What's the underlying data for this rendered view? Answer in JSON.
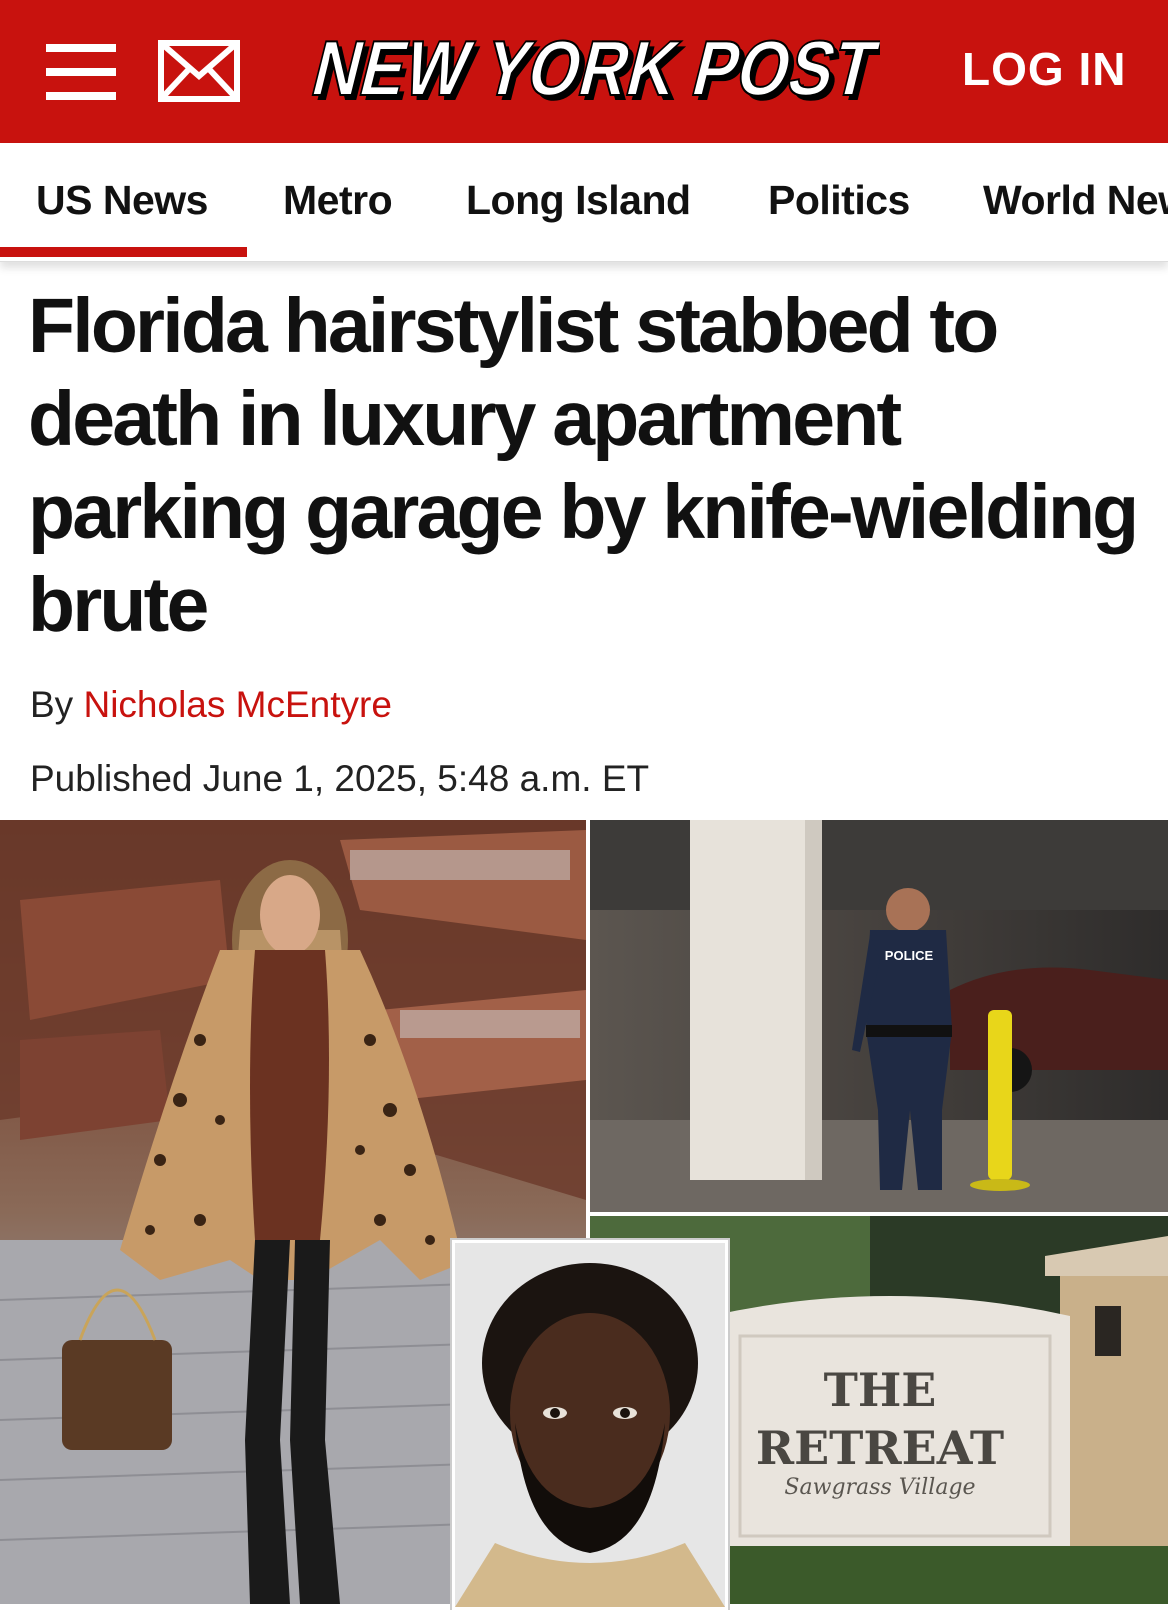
{
  "header": {
    "logo_text": "NEW YORK POST",
    "login_label": "LOG IN",
    "brand_color": "#c8120e",
    "icons": [
      "menu-icon",
      "mail-icon"
    ]
  },
  "nav": {
    "items": [
      {
        "label": "US News",
        "active": true
      },
      {
        "label": "Metro"
      },
      {
        "label": "Long Island"
      },
      {
        "label": "Politics"
      },
      {
        "label": "World News"
      }
    ]
  },
  "article": {
    "headline": "Florida hairstylist stabbed to death in luxury apartment parking garage by knife-wielding brute",
    "byline_prefix": "By",
    "author": "Nicholas McEntyre",
    "published": "Published June 1, 2025, 5:48 a.m. ET"
  },
  "photos": {
    "police_vest_text": "POLICE",
    "sign_line1": "THE",
    "sign_line2": "RETREAT",
    "sign_script": "Sawgrass Village"
  }
}
